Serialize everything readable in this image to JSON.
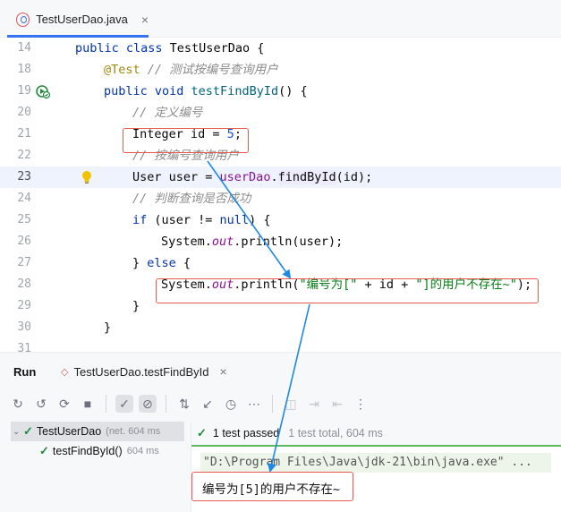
{
  "editor_tab": {
    "label": "TestUserDao.java",
    "close": "×"
  },
  "lines": [
    {
      "num": "14",
      "tokens": [
        {
          "c": "kw",
          "t": "public class "
        },
        {
          "c": "",
          "t": "TestUserDao {"
        }
      ]
    },
    {
      "num": "18",
      "tokens": [
        {
          "c": "ann",
          "t": "@Test "
        },
        {
          "c": "cm",
          "t": "// 测试按编号查询用户"
        }
      ]
    },
    {
      "num": "19",
      "tokens": [
        {
          "c": "kw",
          "t": "public void "
        },
        {
          "c": "fn",
          "t": "testFindById"
        },
        {
          "c": "",
          "t": "() {"
        }
      ]
    },
    {
      "num": "20",
      "tokens": [
        {
          "c": "cm",
          "t": "// 定义编号"
        }
      ]
    },
    {
      "num": "21",
      "tokens": [
        {
          "c": "",
          "t": "Integer id = "
        },
        {
          "c": "num",
          "t": "5"
        },
        {
          "c": "",
          "t": ";"
        }
      ]
    },
    {
      "num": "22",
      "tokens": [
        {
          "c": "cm",
          "t": "// 按编号查询用户"
        }
      ]
    },
    {
      "num": "23",
      "tokens": [
        {
          "c": "",
          "t": "User user = "
        },
        {
          "c": "iv",
          "t": "userDao"
        },
        {
          "c": "",
          "t": "."
        },
        {
          "c": "hl",
          "t": "findById"
        },
        {
          "c": "",
          "t": "(id);"
        }
      ]
    },
    {
      "num": "24",
      "tokens": [
        {
          "c": "cm",
          "t": "// 判断查询是否成功"
        }
      ]
    },
    {
      "num": "25",
      "tokens": [
        {
          "c": "kw",
          "t": "if "
        },
        {
          "c": "",
          "t": "(user != "
        },
        {
          "c": "kw",
          "t": "null"
        },
        {
          "c": "",
          "t": ") {"
        }
      ]
    },
    {
      "num": "26",
      "tokens": [
        {
          "c": "",
          "t": "System."
        },
        {
          "c": "fld",
          "t": "out"
        },
        {
          "c": "",
          "t": ".println(user);"
        }
      ]
    },
    {
      "num": "27",
      "tokens": [
        {
          "c": "",
          "t": "} "
        },
        {
          "c": "kw",
          "t": "else "
        },
        {
          "c": "",
          "t": "{"
        }
      ]
    },
    {
      "num": "28",
      "tokens": [
        {
          "c": "",
          "t": "System."
        },
        {
          "c": "fld",
          "t": "out"
        },
        {
          "c": "",
          "t": ".println("
        },
        {
          "c": "str",
          "t": "\"编号为[\""
        },
        {
          "c": "",
          "t": " + id + "
        },
        {
          "c": "str",
          "t": "\"]的用户不存在~\""
        },
        {
          "c": "",
          "t": ");"
        }
      ]
    },
    {
      "num": "29",
      "tokens": [
        {
          "c": "",
          "t": "}"
        }
      ]
    },
    {
      "num": "30",
      "tokens": [
        {
          "c": "",
          "t": "}"
        }
      ]
    },
    {
      "num": "31",
      "tokens": []
    }
  ],
  "run": {
    "title": "Run",
    "tab_label": "TestUserDao.testFindById",
    "tab_close": "×",
    "tree": [
      {
        "name": "TestUserDao",
        "meta": "(net. 604 ms"
      },
      {
        "name": "testFindById()",
        "meta": "604 ms"
      }
    ],
    "status_main": "1 test passed",
    "status_sub": "1 test total, 604 ms",
    "command": "\"D:\\Program Files\\Java\\jdk-21\\bin\\java.exe\" ...",
    "output": "编号为[5]的用户不存在~"
  },
  "icons": {
    "toolbar": [
      "rerun-icon",
      "rerun-failed-icon",
      "toggle-auto-test-icon",
      "stop-icon",
      "show-passed-icon",
      "show-ignored-icon",
      "sort-alphabetically-icon",
      "sort-by-duration-icon",
      "history-icon",
      "screenshot-icon",
      "import-tests-icon",
      "export-tests-icon",
      "more-icon"
    ]
  },
  "colors": {
    "accent": "#3574f0",
    "highlight_box": "#e85a4f",
    "arrow": "#1e88e5",
    "pass": "#208a3c"
  }
}
